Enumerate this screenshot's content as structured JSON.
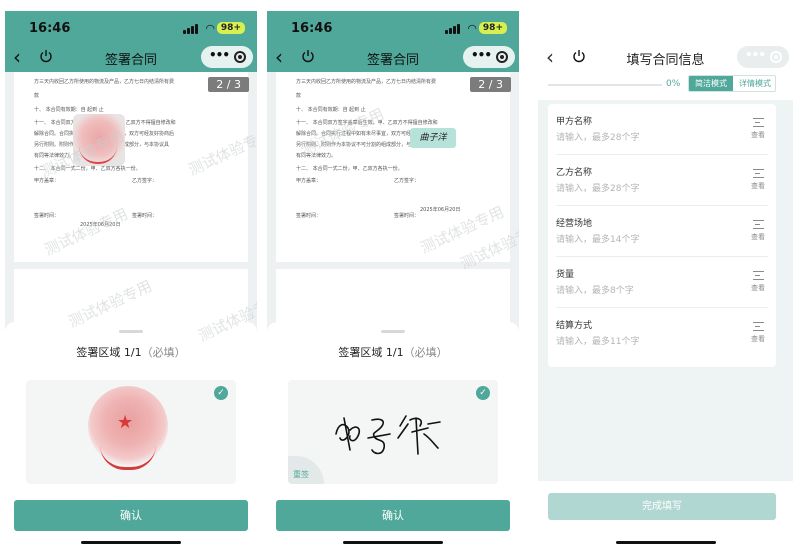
{
  "status": {
    "time": "16:46",
    "battery": "98+"
  },
  "phone1": {
    "title": "签署合同",
    "page_indicator": "2 / 3",
    "doc_text": {
      "line0": "方三天内收回乙方所使用的物流及产品，乙方七日内结清所有费",
      "line1": "款",
      "line2": "十、      本合同有效期：自                    起到                    止",
      "line3": "十一、     本合同双方签字盖章后生效，甲、乙双方不得擅自修改和",
      "line4": "解除合同。合同执行过程中如有未尽事宜，双方可经友好协商后",
      "line5": "另行附则。附则作为本协议不可分割的组成部分，与本协议具",
      "line6": "有同等法律效力。",
      "line7": "十二、     本合同一式二份，甲、乙双方各执一份。",
      "party_a": "甲方盖章：",
      "party_b": "乙方签字：",
      "sign_time_a": "签署时间：",
      "sign_time_b": "签署时间：",
      "date": "2025年06月20日"
    },
    "watermark": "测试体验专用",
    "sheet_title": "签署区域 1/1",
    "sheet_required": "（必填）",
    "confirm": "确认"
  },
  "phone2": {
    "title": "签署合同",
    "page_indicator": "2 / 3",
    "doc_text": {
      "line0": "方三天内收回乙方所使用的物流及产品，乙方七日内结清所有费",
      "line1": "款",
      "line2": "十、      本合同有效期：自                    起到                    止",
      "line3": "十一、     本合同双方签字盖章后生效，甲、乙双方不得擅自修改和",
      "line4": "解除合同。合同执行过程中如有未尽事宜，双方可经友好协商后",
      "line5": "另行附则。附则作为本协议不可分割的组成部分，与本协议具",
      "line6": "有同等法律效力。",
      "line7": "十二、     本合同一式二份，甲、乙双方各执一份。",
      "party_a": "甲方盖章：",
      "party_b": "乙方签字：",
      "sign_time_a": "签署时间：",
      "sign_time_b": "签署时间：",
      "date": "2025年06月20日",
      "sig_text": "曲子洋"
    },
    "watermark": "测试体验专用",
    "sheet_title": "签署区域 1/1",
    "sheet_required": "（必填）",
    "redo": "重签",
    "confirm": "确认"
  },
  "phone3": {
    "title": "填写合同信息",
    "progress": {
      "value": 0,
      "label": "0%"
    },
    "modes": {
      "simple": "简洁模式",
      "detail": "详情模式"
    },
    "fields": [
      {
        "label": "甲方名称",
        "placeholder": "请输入，最多28个字",
        "action": "查看"
      },
      {
        "label": "乙方名称",
        "placeholder": "请输入，最多28个字",
        "action": "查看"
      },
      {
        "label": "经营场地",
        "placeholder": "请输入，最多14个字",
        "action": "查看"
      },
      {
        "label": "货量",
        "placeholder": "请输入，最多8个字",
        "action": "查看"
      },
      {
        "label": "结算方式",
        "placeholder": "请输入，最多11个字",
        "action": "查看"
      }
    ],
    "finish": "完成填写"
  },
  "colors": {
    "accent": "#4fa89a",
    "accent_disabled": "#b0d7d1",
    "seal": "#d63b3b"
  }
}
